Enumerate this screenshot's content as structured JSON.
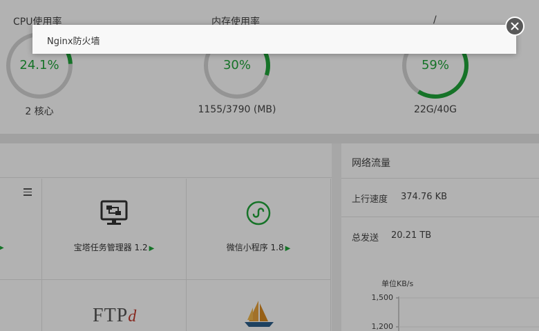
{
  "status": {
    "cpu": {
      "title": "CPU使用率",
      "value": "24.1%",
      "sub": "2 核心",
      "percent": 24.1
    },
    "memory": {
      "title": "内存使用率",
      "value": "30%",
      "sub": "1155/3790 (MB)",
      "percent": 30
    },
    "disk": {
      "title": "/",
      "value": "59%",
      "sub": "22G/40G",
      "percent": 59
    }
  },
  "software": {
    "tiles": [
      {
        "label": "宝塔任务管理器 1.2",
        "icon": "task-manager-icon"
      },
      {
        "label": "微信小程序 1.8",
        "icon": "wechat-miniprogram-icon"
      },
      {
        "label": "",
        "icon": "ftpd-icon",
        "logo_text": "FTPd"
      },
      {
        "label": "",
        "icon": "sailboat-icon"
      }
    ]
  },
  "network": {
    "title": "网络流量",
    "upload_label": "上行速度",
    "upload_value": "374.76 KB",
    "total_sent_label": "总发送",
    "total_sent_value": "20.21 TB",
    "chart_unit": "单位KB/s",
    "ticks": [
      "1,500",
      "1,200"
    ]
  },
  "modal": {
    "title": "Nginx防火墙"
  },
  "colors": {
    "accent": "#20a53a",
    "ring_bg": "#d5d5d5",
    "overlay": "rgba(0,0,0,0.3)"
  }
}
